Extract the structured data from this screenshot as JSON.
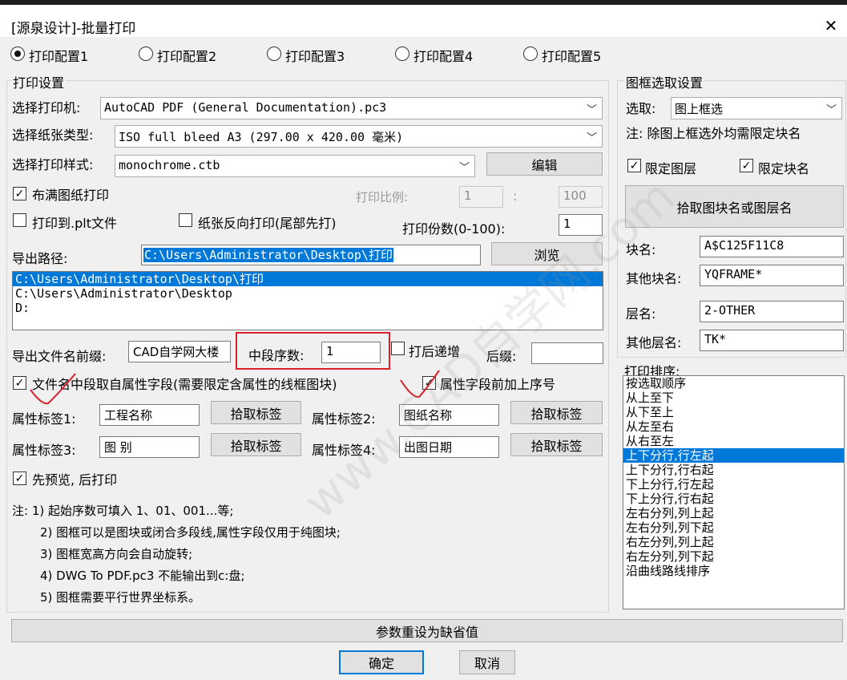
{
  "window": {
    "title": "[源泉设计]-批量打印",
    "close_glyph": "✕"
  },
  "config_tabs": [
    {
      "label": "打印配置1",
      "selected": true
    },
    {
      "label": "打印配置2",
      "selected": false
    },
    {
      "label": "打印配置3",
      "selected": false
    },
    {
      "label": "打印配置4",
      "selected": false
    },
    {
      "label": "打印配置5",
      "selected": false
    }
  ],
  "print_settings": {
    "group_label": "打印设置",
    "printer_label": "选择打印机:",
    "printer_value": "AutoCAD PDF (General Documentation).pc3",
    "paper_label": "选择纸张类型:",
    "paper_value": "ISO full bleed A3 (297.00 x 420.00 毫米)",
    "style_label": "选择打印样式:",
    "style_value": "monochrome.ctb",
    "edit_button": "编辑",
    "fit_paper_label": "布满图纸打印",
    "fit_paper_checked": true,
    "scale_label": "打印比例:",
    "scale_left": "1",
    "scale_sep": ":",
    "scale_right": "100",
    "plt_label": "打印到.plt文件",
    "plt_checked": false,
    "reverse_label": "纸张反向打印(尾部先打)",
    "reverse_checked": false,
    "copies_label": "打印份数(0-100):",
    "copies_value": "1",
    "export_path_label": "导出路径:",
    "export_path_value": "C:\\Users\\Administrator\\Desktop\\打印",
    "browse_button": "浏览",
    "path_list": [
      "C:\\Users\\Administrator\\Desktop\\打印",
      "C:\\Users\\Administrator\\Desktop",
      "D:"
    ],
    "prefix_label": "导出文件名前缀:",
    "prefix_value": "CAD自学网大楼",
    "mid_label": "中段序数:",
    "mid_value": "1",
    "increment_label": "打后递增",
    "increment_checked": false,
    "suffix_label": "后缀:",
    "suffix_value": "",
    "attr_mid_label": "文件名中段取自属性字段(需要限定含属性的线框图块)",
    "attr_mid_checked": true,
    "attr_prefix_label": "属性字段前加上序号",
    "attr_prefix_checked": true,
    "tag1_label": "属性标签1:",
    "tag1_value": "工程名称",
    "tag2_label": "属性标签2:",
    "tag2_value": "图纸名称",
    "tag3_label": "属性标签3:",
    "tag3_value": "图 别",
    "tag4_label": "属性标签4:",
    "tag4_value": "出图日期",
    "pick_tag_button": "拾取标签",
    "preview_label": "先预览, 后打印",
    "preview_checked": true
  },
  "notes": [
    "注: 1) 起始序数可填入 1、01、001...等;",
    "2) 图框可以是图块或闭合多段线,属性字段仅用于纯图块;",
    "3) 图框宽高方向会自动旋转;",
    "4) DWG To PDF.pc3 不能输出到c:盘;",
    "5) 图框需要平行世界坐标系。"
  ],
  "frame_settings": {
    "group_label": "图框选取设置",
    "select_label": "选取:",
    "select_value": "图上框选",
    "note": "注: 除图上框选外均需限定块名",
    "limit_layer_label": "限定图层",
    "limit_layer_checked": true,
    "limit_block_label": "限定块名",
    "limit_block_checked": true,
    "pick_button": "拾取图块名或图层名",
    "block_label": "块名:",
    "block_value": "A$C125F11C8",
    "other_block_label": "其他块名:",
    "other_block_value": "YQFRAME*",
    "layer_label": "层名:",
    "layer_value": "2-OTHER",
    "other_layer_label": "其他层名:",
    "other_layer_value": "TK*"
  },
  "print_order": {
    "label": "打印排序:",
    "items": [
      "按选取顺序",
      "从上至下",
      "从下至上",
      "从左至右",
      "从右至左",
      "上下分行,行左起",
      "上下分行,行右起",
      "下上分行,行左起",
      "下上分行,行右起",
      "左右分列,列上起",
      "左右分列,列下起",
      "右左分列,列上起",
      "右左分列,列下起",
      "沿曲线路线排序"
    ],
    "selected_index": 5
  },
  "footer": {
    "reset_button": "参数重设为缺省值",
    "ok_button": "确定",
    "cancel_button": "取消"
  },
  "watermark": "www.CAD自学网.com",
  "colors": {
    "selection": "#0078d7",
    "annotation_red": "#d9202a",
    "default_button_border": "#0078d7"
  }
}
